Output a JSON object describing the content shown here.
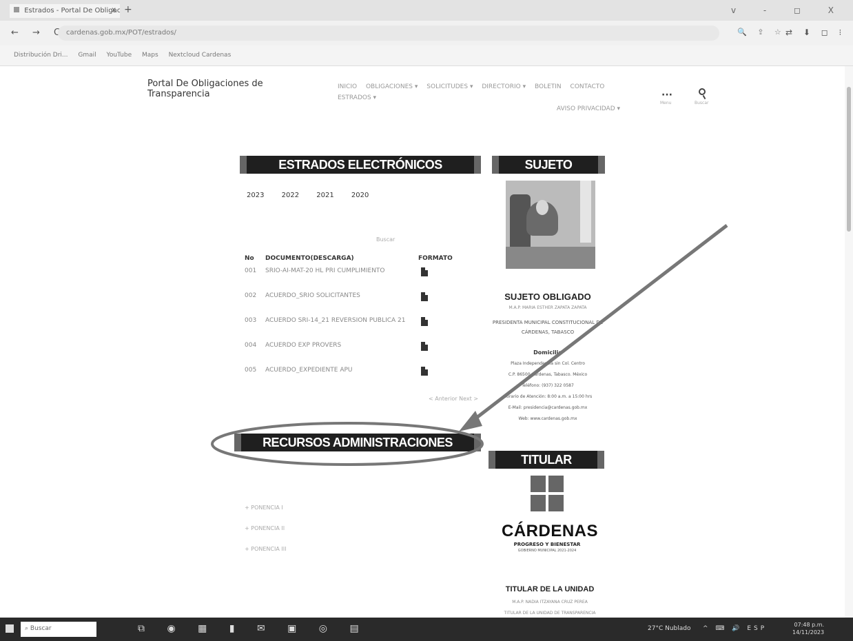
{
  "browser": {
    "tab_title": "Estrados - Portal De Obligacion",
    "tab_close": "x",
    "new_tab": "+",
    "window_controls": "v - ◻ X",
    "nav": "← → C",
    "url": "cardenas.gob.mx/POT/estrados/",
    "bookmarks": [
      "Distribución Dri...",
      "Gmail",
      "YouTube",
      "Maps",
      "Nextcloud Cardenas"
    ]
  },
  "header": {
    "site_title": "Portal De Obligaciones de Transparencia",
    "nav_row1": [
      "INICIO",
      "OBLIGACIONES ▾",
      "SOLICITUDES ▾",
      "DIRECTORIO ▾",
      "BOLETIN",
      "CONTACTO",
      "ESTRADOS ▾"
    ],
    "nav_row2": [
      "AVISO PRIVACIDAD ▾"
    ],
    "more_label": "Menu",
    "search_label": "Buscar"
  },
  "estrados": {
    "title": "ESTRADOS ELECTRÓNICOS",
    "years": [
      "2023",
      "2022",
      "2021",
      "2020"
    ],
    "search_hint": "Buscar",
    "columns": {
      "no": "No",
      "doc": "DOCUMENTO(DESCARGA)",
      "format": "FORMATO"
    },
    "rows": [
      {
        "no": "001",
        "doc": "SRIO-AI-MAT-20 HL PRI CUMPLIMIENTO"
      },
      {
        "no": "002",
        "doc": "ACUERDO_SRIO SOLICITANTES"
      },
      {
        "no": "003",
        "doc": "ACUERDO SRI-14_21 REVERSION PUBLICA 21"
      },
      {
        "no": "004",
        "doc": "ACUERDO EXP PROVERS"
      },
      {
        "no": "005",
        "doc": "ACUERDO_EXPEDIENTE APU"
      }
    ],
    "pagination": "< Anterior  Next >"
  },
  "sujeto": {
    "banner": "SUJETO OBLIGADO",
    "title": "SUJETO OBLIGADO",
    "name": "M.A.P. MARIA ESTHER ZAPATA ZAPATA",
    "role": "PRESIDENTA MUNICIPAL CONSTITUCIONAL DE CÁRDENAS, TABASCO",
    "domicilio_label": "Domicilio",
    "contact": [
      "Plaza Independencia sin Col. Centro",
      "C.P. 86500 Cárdenas, Tabasco. México",
      "Teléfono: (937) 322 0587",
      "Horario de Atención: 8:00 a.m. a 15:00 hrs",
      "E-Mail: presidencia@cardenas.gob.mx",
      "Web: www.cardenas.gob.mx"
    ]
  },
  "recursos": {
    "title": "RECURSOS ADMINISTRACIONES PASADAS",
    "links": [
      "+ PONENCIA I",
      "+ PONENCIA II",
      "+ PONENCIA III"
    ]
  },
  "titular": {
    "banner": "TITULAR",
    "logo_word": "CÁRDENAS",
    "logo_sub": "PROGRESO Y BIENESTAR",
    "logo_period": "GOBIERNO MUNICIPAL 2021-2024",
    "unidad_title": "TITULAR DE LA UNIDAD",
    "name": "M.A.P. NADIA ITZAYANA CRUZ PEREA",
    "role": "TITULAR DE LA UNIDAD DE TRANSPARENCIA"
  },
  "taskbar": {
    "search": "Buscar",
    "weather": "27°C Nublado",
    "tray": "^ ⌨ 🔊 ESP",
    "time": "07:48 p.m.",
    "date": "14/11/2023"
  },
  "colors": {
    "banner_bg": "#1f1f1f",
    "annotation": "#777777"
  }
}
